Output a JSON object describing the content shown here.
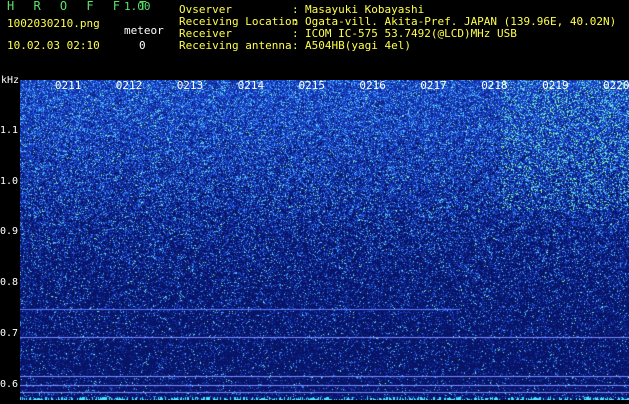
{
  "header": {
    "app_title": "H R O F F T",
    "app_version": "1.00",
    "file_name": "1002030210.png",
    "datetime": "10.02.03 02:10",
    "meteor_label": "meteor",
    "meteor_count": "0"
  },
  "info": [
    {
      "label": "Ovserver",
      "value": "Masayuki Kobayashi"
    },
    {
      "label": "Receiving Location",
      "value": "Ogata-vill. Akita-Pref. JAPAN (139.96E, 40.02N)"
    },
    {
      "label": "Receiver",
      "value": "ICOM IC-575 53.7492(@LCD)MHz USB"
    },
    {
      "label": "Receiving antenna",
      "value": "A504HB(yagi 4el)"
    }
  ],
  "colon": ":",
  "colors": {
    "background": "#000000",
    "title_green": "#59e26a",
    "text_yellow": "#ffff4a",
    "spectrogram_base": "#0a1a7a",
    "spectrogram_noise": "#3a9cff",
    "spectrogram_peak": "#7cff9c",
    "baseline_cyan": "#3fe0ff"
  },
  "chart_data": {
    "type": "heatmap",
    "ylabel": "kHz",
    "y_ticks": [
      "1.1",
      "1.0",
      "0.9",
      "0.8",
      "0.7",
      "0.6"
    ],
    "y_range": [
      0.57,
      1.2
    ],
    "x_ticks": [
      "0211",
      "0212",
      "0213",
      "0214",
      "0215",
      "0216",
      "0217",
      "0218",
      "0219",
      "0220"
    ],
    "x_range_minutes": [
      "0210",
      "0220"
    ],
    "noise_density_by_khz": [
      {
        "khz": 1.18,
        "density": 0.95
      },
      {
        "khz": 1.1,
        "density": 0.85
      },
      {
        "khz": 1.0,
        "density": 0.65
      },
      {
        "khz": 0.9,
        "density": 0.42
      },
      {
        "khz": 0.8,
        "density": 0.28
      },
      {
        "khz": 0.7,
        "density": 0.2
      },
      {
        "khz": 0.6,
        "density": 0.15
      }
    ],
    "horizontal_lines_khz": [
      0.75,
      0.695,
      0.618,
      0.6,
      0.585
    ],
    "baseline_cyan_khz": 0.575
  }
}
